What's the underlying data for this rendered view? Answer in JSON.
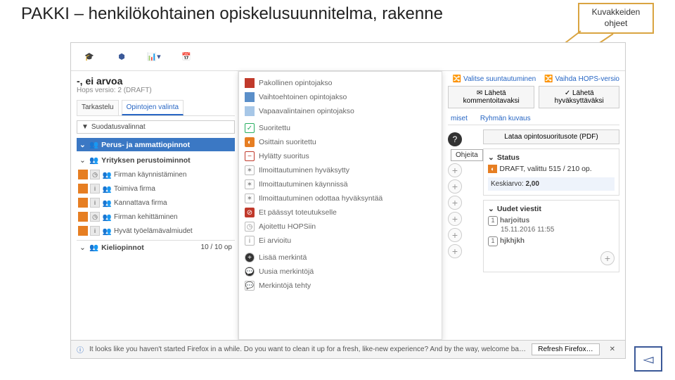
{
  "slide": {
    "title": "PAKKI – henkilökohtainen opiskelusuunnitelma, rakenne"
  },
  "callout": {
    "line1": "Kuvakkeiden",
    "line2": "ohjeet"
  },
  "hops": {
    "title": "-, ei arvoa",
    "sub": "Hops versio: 2 (DRAFT)"
  },
  "tabs": {
    "t1": "Tarkastelu",
    "t2": "Opintojen valinta"
  },
  "filter": "Suodatusvalinnat",
  "groups": {
    "g1": "Perus- ja ammattiopinnot",
    "g2": "Yrityksen perustoiminnot",
    "r1": "Firman käynnistäminen",
    "r2": "Toimiva firma",
    "r3": "Kannattava firma",
    "r4": "Firman kehittäminen",
    "r5": "Hyvät työelämävalmiudet",
    "g3": "Kieliopinnot",
    "g3op": "10 / 10 op"
  },
  "legend": {
    "l1": "Pakollinen opintojakso",
    "l2": "Vaihtoehtoinen opintojakso",
    "l3": "Vapaavalintainen opintojakso",
    "l4": "Suoritettu",
    "l5": "Osittain suoritettu",
    "l6": "Hylätty suoritus",
    "l7": "Ilmoittautuminen hyväksytty",
    "l8": "Ilmoittautuminen käynnissä",
    "l9": "Ilmoittautuminen odottaa hyväksyntää",
    "l10": "Et päässyt toteutukselle",
    "l11": "Ajoitettu HOPSiin",
    "l12": "Ei arvioitu",
    "l13": "Lisää merkintä",
    "l14": "Uusia merkintöjä",
    "l15": "Merkintöjä tehty"
  },
  "right": {
    "link1": "Valitse suuntautuminen",
    "link2": "Vaihda HOPS-versio",
    "btn1": "Lähetä kommentoitavaksi",
    "btn2": "Lähetä hyväksyttäväksi",
    "tab1": "miset",
    "tab2": "Ryhmän kuvaus",
    "pdf": "Lataa opintosuoritusote (PDF)",
    "tooltip": "Ohjeita",
    "status": "Status",
    "draft": "DRAFT, valittu 515 / 210 op.",
    "avg_label": "Keskiarvo:",
    "avg_val": "2,00",
    "msgs": "Uudet viestit",
    "m1": "harjoitus",
    "m1d": "15.11.2016 11:55",
    "m2": "hjkhjkh"
  },
  "firefox": {
    "text": "It looks like you haven't started Firefox in a while. Do you want to clean it up for a fresh, like-new experience? And by the way, welcome back!",
    "btn": "Refresh Firefox…"
  }
}
